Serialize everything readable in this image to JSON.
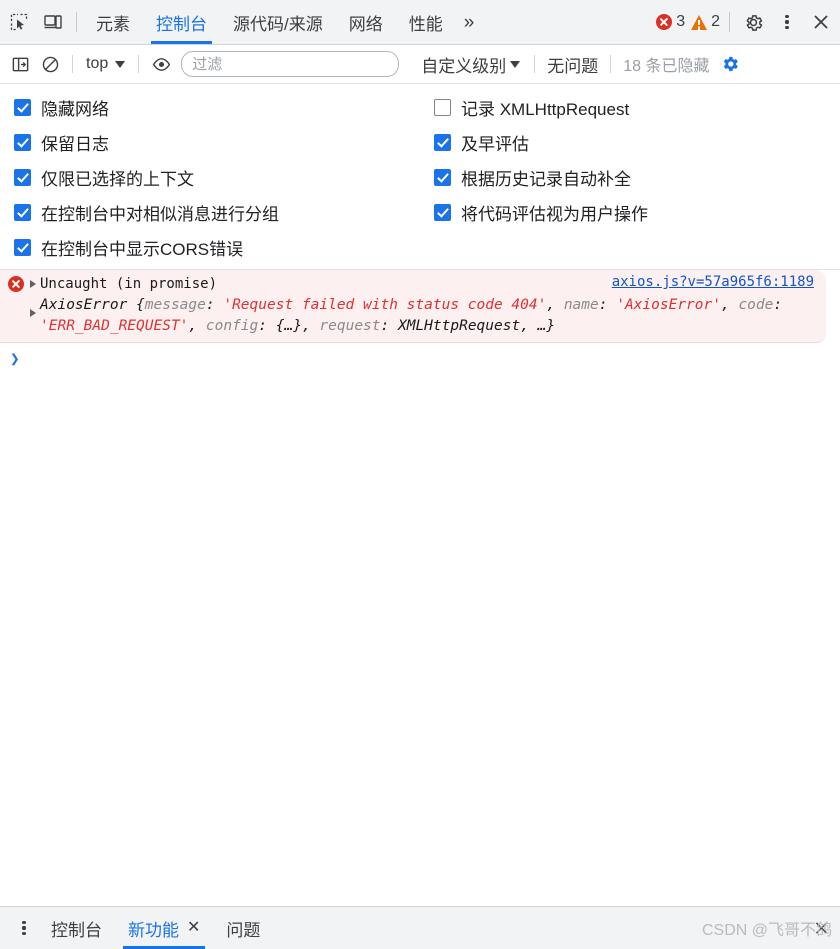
{
  "tabbar": {
    "inspect_icon": "inspect-element-icon",
    "device_icon": "device-toolbar-icon",
    "tabs": [
      {
        "label": "元素",
        "active": false
      },
      {
        "label": "控制台",
        "active": true
      },
      {
        "label": "源代码/来源",
        "active": false
      },
      {
        "label": "网络",
        "active": false
      },
      {
        "label": "性能",
        "active": false
      }
    ],
    "more_tabs": "»",
    "error_count": "3",
    "warning_count": "2",
    "settings_icon": "gear-icon",
    "menu_icon": "kebab-menu-icon",
    "close_icon": "✕"
  },
  "consolebar": {
    "sidebar_icon": "console-sidebar-icon",
    "clear_icon": "clear-console-icon",
    "context": "top",
    "eye_icon": "live-expression-icon",
    "filter_placeholder": "过滤",
    "filter_value": "",
    "level": "自定义级别",
    "issues": "无问题",
    "hidden": "18 条已隐藏",
    "settings_gear": "gear-icon"
  },
  "settings": {
    "left": [
      {
        "label": "隐藏网络",
        "checked": true
      },
      {
        "label": "保留日志",
        "checked": true
      },
      {
        "label": "仅限已选择的上下文",
        "checked": true
      },
      {
        "label": "在控制台中对相似消息进行分组",
        "checked": true
      },
      {
        "label": "在控制台中显示CORS错误",
        "checked": true
      }
    ],
    "right": [
      {
        "label": "记录 XMLHttpRequest",
        "checked": false
      },
      {
        "label": "及早评估",
        "checked": true
      },
      {
        "label": "根据历史记录自动补全",
        "checked": true
      },
      {
        "label": "将代码评估视为用户操作",
        "checked": true
      }
    ]
  },
  "console": {
    "error": {
      "icon": "error-circle-icon",
      "title": "Uncaught (in promise)",
      "source_link": "axios.js?v=57a965f6:1189",
      "object_name": "AxiosError ",
      "parts": [
        {
          "text": "{",
          "kind": "plain"
        },
        {
          "text": "message",
          "kind": "name"
        },
        {
          "text": ": ",
          "kind": "plain"
        },
        {
          "text": "'Request failed with status code 404'",
          "kind": "str"
        },
        {
          "text": ", ",
          "kind": "plain"
        },
        {
          "text": "name",
          "kind": "name"
        },
        {
          "text": ": ",
          "kind": "plain"
        },
        {
          "text": "'AxiosError'",
          "kind": "str"
        },
        {
          "text": ", ",
          "kind": "plain"
        },
        {
          "text": "code",
          "kind": "name"
        },
        {
          "text": ": ",
          "kind": "plain"
        },
        {
          "text": "'ERR_BAD_REQUEST'",
          "kind": "str"
        },
        {
          "text": ", ",
          "kind": "plain"
        },
        {
          "text": "config",
          "kind": "name"
        },
        {
          "text": ": ",
          "kind": "plain"
        },
        {
          "text": "{…}",
          "kind": "plain"
        },
        {
          "text": ", ",
          "kind": "plain"
        },
        {
          "text": "request",
          "kind": "name"
        },
        {
          "text": ": ",
          "kind": "plain"
        },
        {
          "text": "XMLHttpRequest",
          "kind": "plain"
        },
        {
          "text": ", …}",
          "kind": "plain"
        }
      ]
    },
    "prompt_chevron": "❯"
  },
  "drawer": {
    "menu_icon": "kebab-menu-icon",
    "tabs": [
      {
        "label": "控制台",
        "active": false,
        "closable": false
      },
      {
        "label": "新功能",
        "active": true,
        "closable": true
      },
      {
        "label": "问题",
        "active": false,
        "closable": false
      }
    ],
    "close_label": "✕",
    "watermark": "CSDN @飞哥不鸽"
  },
  "colors": {
    "accent": "#1a73e8",
    "error": "#d93025",
    "warning": "#e8710a",
    "error_bg": "#fcf0f0",
    "link": "#1155cc",
    "toolbar_bg": "#f1f3f4"
  }
}
